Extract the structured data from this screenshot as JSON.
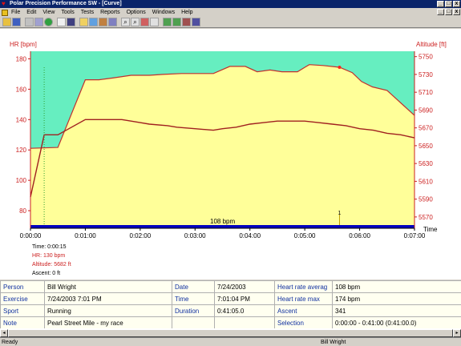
{
  "window": {
    "title": "Polar Precision Performance SW - [Curve]",
    "min": "_",
    "max": "□",
    "close": "x"
  },
  "menu": {
    "items": [
      "File",
      "Edit",
      "View",
      "Tools",
      "Tests",
      "Reports",
      "Options",
      "Windows",
      "Help"
    ]
  },
  "toolbar": {
    "icons": [
      "open-icon",
      "save-icon",
      "print-icon",
      "export-icon",
      "globe-icon",
      "calendar-icon",
      "database-icon",
      "folder-icon",
      "chart-icon",
      "compare-icon",
      "bars-icon",
      "zoom-icon",
      "zoom-out-icon",
      "settings-icon",
      "curve-icon",
      "graph-a-icon",
      "graph-b-icon",
      "graph-c-icon",
      "graph-d-icon"
    ]
  },
  "chart_data": {
    "type": "line",
    "ylabel_left": "HR [bpm]",
    "ylabel_right": "Altitude [ft]",
    "xlabel": "Time",
    "x_ticks": [
      "0:00:00",
      "0:01:00",
      "0:02:00",
      "0:03:00",
      "0:04:00",
      "0:05:00",
      "0:06:00",
      "0:07:00"
    ],
    "y_left_ticks": [
      "180",
      "160",
      "140",
      "120",
      "100",
      "80"
    ],
    "y_left_range": [
      70,
      185
    ],
    "y_right_ticks": [
      "5750",
      "5730",
      "5710",
      "5690",
      "5670",
      "5650",
      "5630",
      "5610",
      "5590",
      "5570"
    ],
    "y_right_range": [
      5560,
      5756
    ],
    "hr_series": {
      "name": "HR",
      "x_sec": [
        0,
        15,
        20,
        30,
        60,
        80,
        90,
        100,
        110,
        120,
        130,
        150,
        160,
        180,
        200,
        210,
        225,
        240,
        255,
        270,
        285,
        300,
        315,
        330,
        345,
        360,
        375,
        390,
        405,
        420
      ],
      "y": [
        89,
        130,
        130,
        130,
        140,
        140,
        140,
        140,
        139,
        138,
        137,
        136,
        135,
        134,
        133,
        134,
        135,
        137,
        138,
        139,
        139,
        139,
        138,
        137,
        136,
        134,
        133,
        131,
        130,
        128
      ]
    },
    "altitude_series": {
      "name": "Altitude",
      "x_sec": [
        0,
        30,
        60,
        75,
        90,
        110,
        130,
        145,
        165,
        180,
        200,
        218,
        235,
        248,
        262,
        275,
        292,
        305,
        320,
        338,
        352,
        362,
        374,
        390,
        405,
        420
      ],
      "y": [
        5647,
        5648,
        5724,
        5724,
        5726,
        5729,
        5729,
        5730,
        5731,
        5731,
        5731,
        5739,
        5739,
        5733,
        5735,
        5733,
        5733,
        5741,
        5740,
        5738,
        5732,
        5722,
        5716,
        5712,
        5698,
        5684
      ]
    },
    "average_label": "108 bpm",
    "cursor": {
      "time": "Time: 0:00:15",
      "hr": "HR: 130 bpm",
      "altitude": "Altitude: 5682 ft",
      "ascent": "Ascent: 0 ft",
      "x_sec": 15
    },
    "marker": {
      "label": "1",
      "x_sec": 338
    },
    "colors": {
      "hr": "#a02020",
      "altitude_line": "#c03030",
      "altitude_fill": "#ffff99",
      "background": "#66eec0",
      "axis_red": "#cc2020",
      "avg_bar": "#0000c0"
    }
  },
  "details": {
    "rows": [
      {
        "l1": "Person",
        "v1": "Bill Wright",
        "l2": "Date",
        "v2": "7/24/2003",
        "l3": "Heart rate averag",
        "v3": "108 bpm"
      },
      {
        "l1": "Exercise",
        "v1": "7/24/2003 7:01 PM",
        "l2": "Time",
        "v2": "7:01:04 PM",
        "l3": "Heart rate max",
        "v3": "174 bpm"
      },
      {
        "l1": "Sport",
        "v1": "Running",
        "l2": "Duration",
        "v2": "0:41:05.0",
        "l3": "Ascent",
        "v3": "341"
      },
      {
        "l1": "Note",
        "v1": "Pearl Street Mile - my race",
        "l2": "",
        "v2": "",
        "l3": "Selection",
        "v3": "0:00:00 - 0:41:00 (0:41:00.0)"
      }
    ]
  },
  "status": {
    "left": "Ready",
    "right": "Bill Wright"
  }
}
